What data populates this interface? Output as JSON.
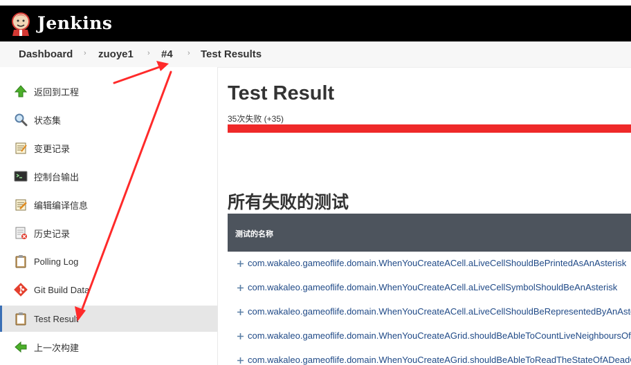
{
  "header": {
    "brand": "Jenkins"
  },
  "breadcrumb": {
    "items": [
      "Dashboard",
      "zuoye1",
      "#4",
      "Test Results"
    ]
  },
  "sidebar": {
    "items": [
      {
        "label": "返回到工程",
        "icon": "up-arrow-icon"
      },
      {
        "label": "状态集",
        "icon": "magnifier-icon"
      },
      {
        "label": "变更记录",
        "icon": "notepad-icon"
      },
      {
        "label": "控制台输出",
        "icon": "terminal-icon"
      },
      {
        "label": "编辑编译信息",
        "icon": "notepad-edit-icon"
      },
      {
        "label": "历史记录",
        "icon": "delete-document-icon"
      },
      {
        "label": "Polling Log",
        "icon": "clipboard-icon"
      },
      {
        "label": "Git Build Data",
        "icon": "git-icon"
      },
      {
        "label": "Test Result",
        "icon": "clipboard-icon"
      },
      {
        "label": "上一次构建",
        "icon": "left-arrow-icon"
      }
    ],
    "active_index": 8
  },
  "main": {
    "title": "Test Result",
    "summary": "35次失败 (+35)",
    "failed_section_title": "所有失败的测试",
    "table_header": "测试的名称",
    "tests": [
      "com.wakaleo.gameoflife.domain.WhenYouCreateACell.aLiveCellShouldBePrintedAsAnAsterisk",
      "com.wakaleo.gameoflife.domain.WhenYouCreateACell.aLiveCellSymbolShouldBeAnAsterisk",
      "com.wakaleo.gameoflife.domain.WhenYouCreateACell.aLiveCellShouldBeRepresentedByAnAsterisk",
      "com.wakaleo.gameoflife.domain.WhenYouCreateAGrid.shouldBeAbleToCountLiveNeighboursOfACell",
      "com.wakaleo.gameoflife.domain.WhenYouCreateAGrid.shouldBeAbleToReadTheStateOfADeadCell"
    ]
  },
  "colors": {
    "header_bg": "#000000",
    "fail_bar": "#ef2929",
    "table_header_bg": "#4d545d",
    "link": "#204a87",
    "annotation_arrow": "#ff2a2a"
  }
}
